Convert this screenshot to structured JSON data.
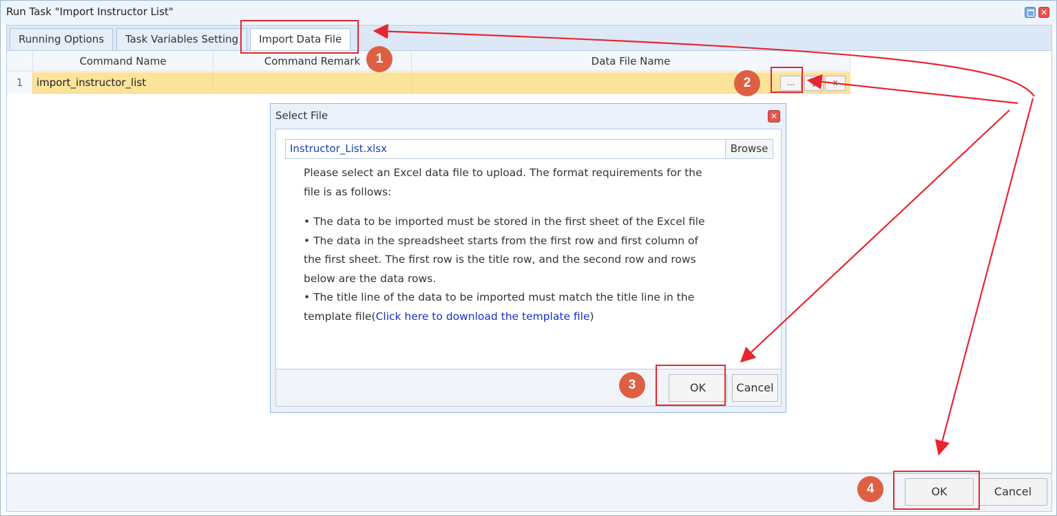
{
  "window": {
    "title": "Run Task \"Import Instructor List\""
  },
  "tabs": [
    {
      "label": "Running Options"
    },
    {
      "label": "Task Variables Setting"
    },
    {
      "label": "Import Data File"
    }
  ],
  "grid": {
    "columns": [
      "Command Name",
      "Command Remark",
      "Data File Name"
    ],
    "rows": [
      {
        "num": "1",
        "command_name": "import_instructor_list",
        "remark": "",
        "data_file": ""
      }
    ],
    "row_buttons": {
      "select": "...",
      "clear": "x"
    }
  },
  "dialog": {
    "title": "Select File",
    "file_value": "Instructor_List.xlsx",
    "browse_label": "Browse",
    "intro": "Please select an Excel data file to upload. The format requirements for the file is as follows:",
    "bullets": [
      "The data to be imported must be stored in the first sheet of the Excel file",
      "The data in the spreadsheet starts from the first row and first column of the first sheet. The first row is the title row, and the second row and rows below are the data rows."
    ],
    "bullet3_prefix": "The title line of the data to be imported must match the title line in the template file(",
    "bullet3_link": "Click here to download the template file",
    "bullet3_suffix": ")",
    "ok_label": "OK",
    "cancel_label": "Cancel"
  },
  "footer": {
    "ok_label": "OK",
    "cancel_label": "Cancel"
  },
  "annotations": {
    "badges": [
      "1",
      "2",
      "3",
      "4"
    ],
    "color": "#e8242f",
    "badge_color": "#dd6042"
  },
  "colors": {
    "selected_row": "#fce39a",
    "link": "#1a2fd0",
    "close": "#e7544e"
  }
}
